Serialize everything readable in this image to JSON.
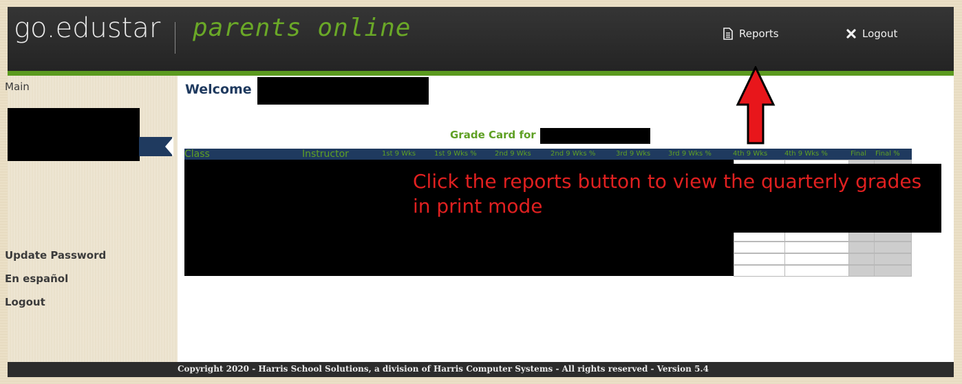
{
  "header": {
    "logo_main": "go.edustar",
    "logo_sub": "parents online",
    "reports_label": "Reports",
    "logout_label": "Logout",
    "reports_icon": "document-icon",
    "logout_icon": "close-x-icon"
  },
  "sidebar": {
    "main_label": "Main",
    "links": [
      "Update Password",
      "En español",
      "Logout"
    ]
  },
  "main": {
    "welcome": "Welcome",
    "grade_card_title": "Grade Card for",
    "columns": [
      "Class",
      "Instructor",
      "1st 9 Wks",
      "1st 9 Wks %",
      "2nd 9 Wks",
      "2nd 9 Wks %",
      "3rd 9 Wks",
      "3rd 9 Wks %",
      "4th 9 Wks",
      "4th 9 Wks %",
      "Final",
      "Final %"
    ]
  },
  "annotation": {
    "text": "Click the reports button to view the quarterly grades in print mode",
    "color": "#e02020"
  },
  "footer": {
    "text": "Copyright 2020 - Harris School Solutions, a division of Harris Computer Systems - All rights reserved - Version 5.4"
  },
  "colors": {
    "brand_green": "#5fa024",
    "nav_blue": "#1f3a5f",
    "header_dark": "#2a2a2a"
  }
}
